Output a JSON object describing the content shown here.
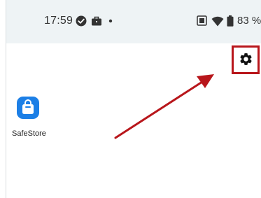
{
  "status_bar": {
    "time": "17:59",
    "battery_percent": "83 %",
    "icons": [
      "check-circle-icon",
      "briefcase-icon",
      "dot-icon",
      "screen-record-icon",
      "wifi-icon",
      "battery-icon"
    ]
  },
  "home": {
    "settings_icon": "gear-icon",
    "apps": [
      {
        "label": "SafeStore",
        "icon": "shopping-bag-icon",
        "color": "#1c7fe6"
      }
    ]
  },
  "annotation": {
    "highlight_color": "#b8161b",
    "arrow_color": "#b8161b"
  }
}
